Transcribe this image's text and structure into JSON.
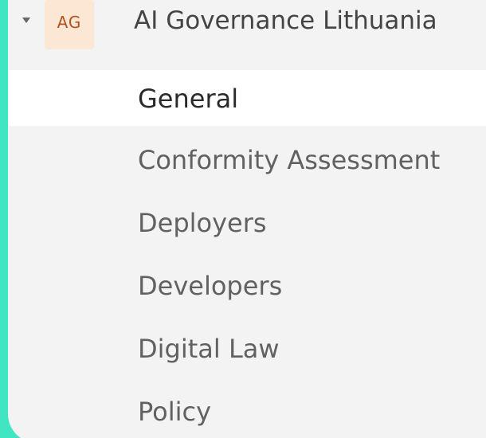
{
  "team": {
    "initials": "AG",
    "name": "AI Governance Lithuania",
    "avatar_color": "#fbe7d3",
    "avatar_text_color": "#b0531d",
    "expanded": true
  },
  "channels": [
    {
      "label": "General",
      "selected": true
    },
    {
      "label": "Conformity Assessment",
      "selected": false
    },
    {
      "label": "Deployers",
      "selected": false
    },
    {
      "label": "Developers",
      "selected": false
    },
    {
      "label": "Digital Law",
      "selected": false
    },
    {
      "label": "Policy",
      "selected": false
    }
  ],
  "colors": {
    "background": "#40e6c2",
    "panel": "#f3f3f3",
    "selected_row": "#ffffff"
  }
}
